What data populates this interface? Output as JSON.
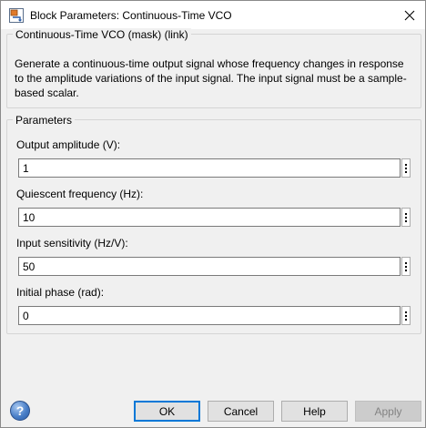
{
  "window": {
    "title": "Block Parameters: Continuous-Time VCO"
  },
  "description": {
    "heading": "Continuous-Time VCO (mask) (link)",
    "text": "Generate a continuous-time output signal whose frequency changes in response to the amplitude variations of the input signal. The input signal must be a sample-based scalar."
  },
  "parameters": {
    "heading": "Parameters",
    "fields": [
      {
        "label": "Output amplitude (V):",
        "value": "1"
      },
      {
        "label": "Quiescent frequency (Hz):",
        "value": "10"
      },
      {
        "label": "Input sensitivity (Hz/V):",
        "value": "50"
      },
      {
        "label": "Initial phase (rad):",
        "value": "0"
      }
    ]
  },
  "buttons": {
    "ok": "OK",
    "cancel": "Cancel",
    "help": "Help",
    "apply": "Apply",
    "help_icon": "?"
  },
  "icons": {
    "app": "block-parameters-icon",
    "close": "close-icon",
    "field_menu": "vertical-ellipsis-icon",
    "help": "help-icon"
  },
  "colors": {
    "default_button_border": "#0078d7",
    "disabled_text": "#838383"
  }
}
